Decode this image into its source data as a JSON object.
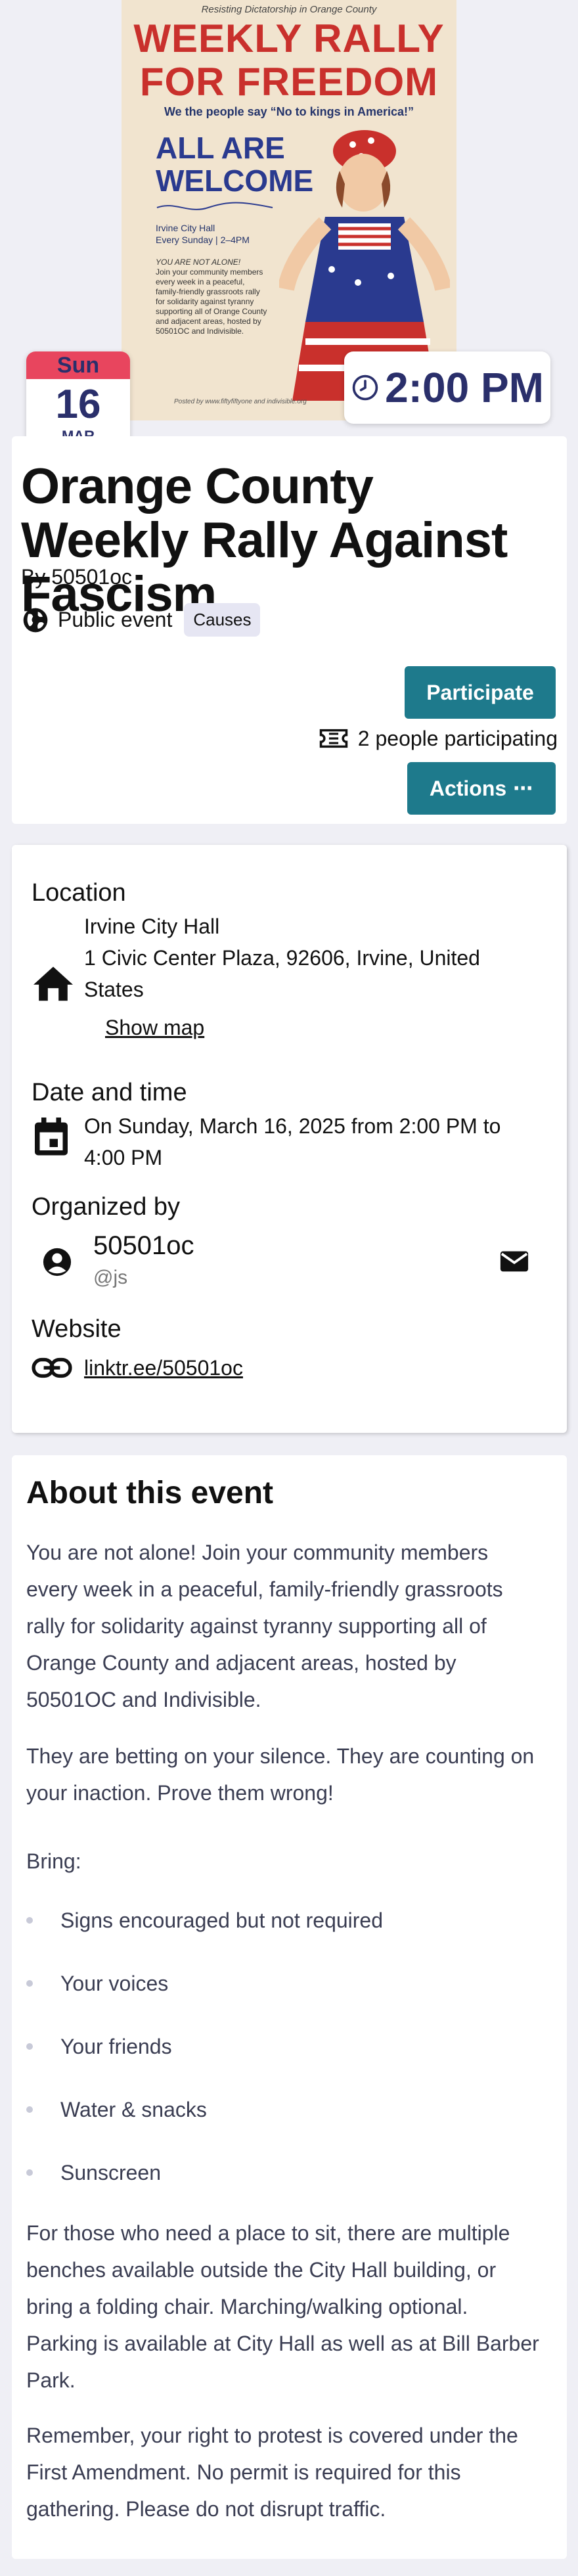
{
  "poster": {
    "tagline": "Resisting Dictatorship in Orange County",
    "headline_1": "WEEKLY RALLY",
    "headline_2": "FOR FREEDOM",
    "we_say": "We the people say “No to kings in America!”",
    "welcome_1": "ALL ARE",
    "welcome_2": "WELCOME",
    "where_1": "Irvine City Hall",
    "where_2": "Every Sunday | 2–4PM",
    "small_1": "YOU ARE NOT ALONE!",
    "small_2": "Join your community members every week in a peaceful, family-friendly grassroots rally for solidarity against tyranny supporting all of Orange County and adjacent areas, hosted by 50501OC and Indivisible.",
    "credit": "Posted by www.fiftyfiftyone and indivisible.org"
  },
  "date_badge": {
    "weekday": "Sun",
    "day": "16",
    "month": "MAR"
  },
  "time_badge": {
    "time": "2:00 PM",
    "icon": "clock-icon"
  },
  "event": {
    "title": "Orange County Weekly Rally Against Fascism",
    "by": "By 50501oc",
    "visibility": "Public event",
    "visibility_icon": "globe-icon",
    "tag": "Causes",
    "participate_label": "Participate",
    "participants_text": "2 people participating",
    "participants_icon": "ticket-icon",
    "actions_label": "Actions",
    "actions_icon": "more-dots-icon"
  },
  "details": {
    "location_title": "Location",
    "location_name": "Irvine City Hall",
    "location_address_1": "1 Civic Center Plaza, 92606, Irvine, United",
    "location_address_2": "States",
    "show_map": "Show map",
    "datetime_title": "Date and time",
    "datetime_1": "On Sunday, March 16, 2025 from 2:00 PM to",
    "datetime_2": "4:00 PM",
    "organizer_title": "Organized by",
    "organizer_name": "50501oc",
    "organizer_handle": "@js",
    "website_title": "Website",
    "website_link": "linktr.ee/50501oc"
  },
  "about": {
    "title": "About this event",
    "p1_lines": [
      "You are not alone! Join your community members",
      "every week in a peaceful, family-friendly grassroots",
      "rally for solidarity against tyranny supporting all of",
      "Orange County and adjacent areas, hosted by",
      "50501OC and Indivisible."
    ],
    "p2_lines": [
      "They are betting on your silence. They are counting on",
      "your inaction. Prove them wrong!"
    ],
    "bring": "Bring:",
    "bullets": [
      "Signs encouraged but not required",
      "Your voices",
      "Your friends",
      "Water & snacks",
      "Sunscreen"
    ],
    "p3_lines": [
      "For those who need a place to sit, there are multiple",
      "benches available outside the City Hall building, or",
      "bring a folding chair. Marching/walking optional.",
      "Parking is available at City Hall as well as at Bill Barber",
      "Park."
    ],
    "p4_lines": [
      "Remember, your right to protest is covered under the",
      "First Amendment. No permit is required for this",
      "gathering. Please do not disrupt traffic."
    ]
  },
  "colors": {
    "accent": "#1e7a8c",
    "badge_red": "#e8455e",
    "badge_text": "#2a2f6b",
    "page_bg": "#efeff5"
  }
}
